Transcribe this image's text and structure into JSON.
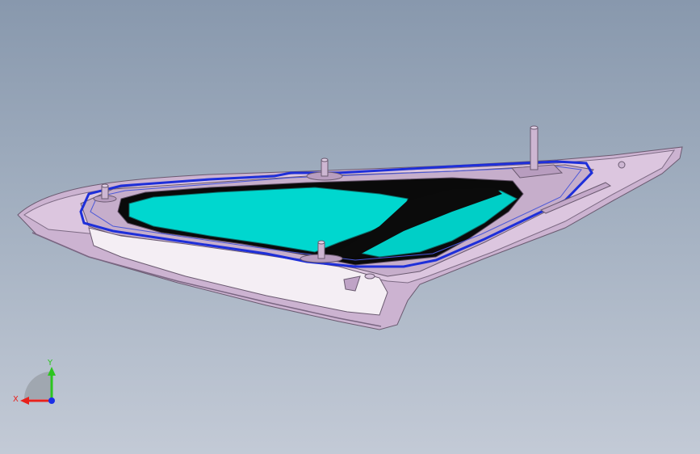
{
  "viewport": {
    "background_top": "#8898ad",
    "background_bottom": "#c3cad6"
  },
  "model": {
    "body_color": "#d8c2dc",
    "glass_color": "#00d7cf",
    "seal_color": "#1e2fd9",
    "pin_count": 4
  },
  "triad": {
    "x_label": "X",
    "y_label": "Y",
    "x_color": "#e8211c",
    "y_color": "#2cc51f",
    "z_color": "#1b2fe6"
  }
}
